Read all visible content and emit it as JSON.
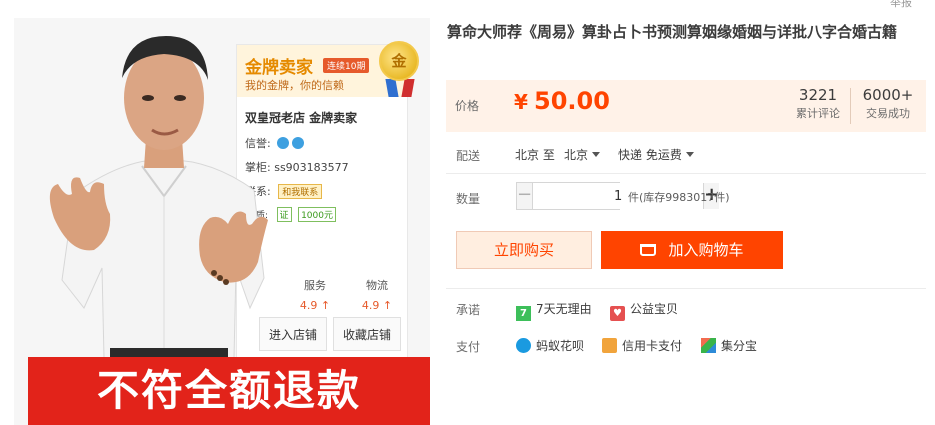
{
  "report_link": "举报",
  "hero": {
    "shop_card": {
      "gold_title": "金牌卖家",
      "gold_tag": "连续10期",
      "gold_sub": "我的金牌，你的信赖",
      "medal_text": "金",
      "shop_name": "双皇冠老店 金牌卖家",
      "credit_label": "信誉:",
      "owner_label": "掌柜:",
      "owner_value": "ss903183577",
      "contact_label": "联系:",
      "contact_button": "和我联系",
      "quals_label": "资质:",
      "badge_cert": "证",
      "badge_deposit": "1000元",
      "score_service_label": "服务",
      "score_service_value": "4.9 ↑",
      "score_logistics_label": "物流",
      "score_logistics_value": "4.9 ↑",
      "enter_shop": "进入店铺",
      "fav_shop": "收藏店铺"
    },
    "refund_banner": "不符全额退款"
  },
  "product": {
    "title": "算命大师荐《周易》算卦占卜书预测算姻缘婚姻与详批八字合婚古籍",
    "price_label": "价格",
    "price_symbol": "¥",
    "price_value": "50.00",
    "reviews_count": "3221",
    "reviews_caption": "累计评论",
    "sales_count": "6000+",
    "sales_caption": "交易成功",
    "shipping_label": "配送",
    "ship_from": "北京 至",
    "ship_to": "北京",
    "ship_method": "快递 免运费",
    "quantity_label": "数量",
    "quantity_minus": "−",
    "quantity_value": "1",
    "quantity_plus": "+",
    "stock_text": "件(库存9983017件)",
    "buy_now": "立即购买",
    "add_to_cart": "加入购物车",
    "promise_label": "承诺",
    "promise_items": [
      "7天无理由",
      "公益宝贝"
    ],
    "promise_icons": [
      "seven-day-icon",
      "charity-heart-icon"
    ],
    "payment_label": "支付",
    "payment_items": [
      "蚂蚁花呗",
      "信用卡支付",
      "集分宝"
    ],
    "payment_icons": [
      "huabei-icon",
      "credit-card-icon",
      "jifenbao-icon"
    ]
  },
  "colors": {
    "price": "#ff4400",
    "buy_now_bg": "#ffeee0",
    "add_cart_bg": "#ff4400",
    "banner_red": "#e2231a",
    "price_panel_bg": "#fff2e8"
  }
}
